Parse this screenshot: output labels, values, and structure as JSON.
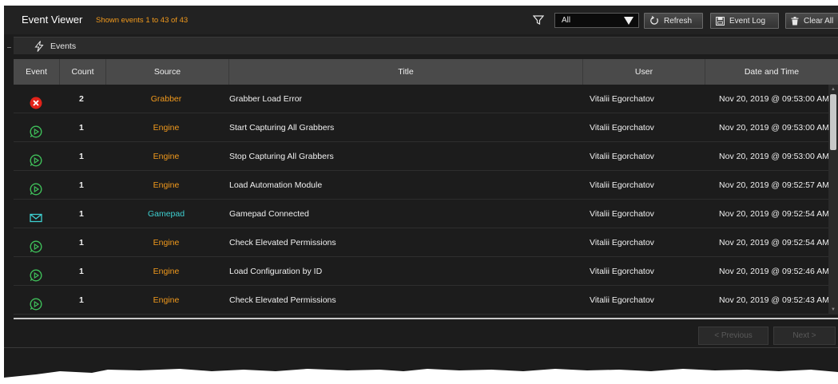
{
  "header": {
    "title": "Event Viewer",
    "shown_text": "Shown events 1 to 43 of 43",
    "filter_value": "All",
    "refresh_label": "Refresh",
    "event_log_label": "Event Log",
    "clear_all_label": "Clear All"
  },
  "section": {
    "label": "Events"
  },
  "columns": [
    "Event",
    "Count",
    "Source",
    "Title",
    "User",
    "Date and Time"
  ],
  "rows": [
    {
      "icon": "error-icon",
      "count": "2",
      "source": "Grabber",
      "title": "Grabber Load Error",
      "user": "Vitalii Egorchatov",
      "date": "Nov 20, 2019 @ 09:53:00 AM"
    },
    {
      "icon": "play-circle-icon",
      "count": "1",
      "source": "Engine",
      "title": "Start Capturing All Grabbers",
      "user": "Vitalii Egorchatov",
      "date": "Nov 20, 2019 @ 09:53:00 AM"
    },
    {
      "icon": "play-circle-icon",
      "count": "1",
      "source": "Engine",
      "title": "Stop Capturing All Grabbers",
      "user": "Vitalii Egorchatov",
      "date": "Nov 20, 2019 @ 09:53:00 AM"
    },
    {
      "icon": "play-circle-icon",
      "count": "1",
      "source": "Engine",
      "title": "Load Automation Module",
      "user": "Vitalii Egorchatov",
      "date": "Nov 20, 2019 @ 09:52:57 AM"
    },
    {
      "icon": "envelope-icon",
      "count": "1",
      "source": "Gamepad",
      "title": "Gamepad Connected",
      "user": "Vitalii Egorchatov",
      "date": "Nov 20, 2019 @ 09:52:54 AM"
    },
    {
      "icon": "play-circle-icon",
      "count": "1",
      "source": "Engine",
      "title": "Check Elevated Permissions",
      "user": "Vitalii Egorchatov",
      "date": "Nov 20, 2019 @ 09:52:54 AM"
    },
    {
      "icon": "play-circle-icon",
      "count": "1",
      "source": "Engine",
      "title": "Load Configuration by ID",
      "user": "Vitalii Egorchatov",
      "date": "Nov 20, 2019 @ 09:52:46 AM"
    },
    {
      "icon": "play-circle-icon",
      "count": "1",
      "source": "Engine",
      "title": "Check Elevated Permissions",
      "user": "Vitalii Egorchatov",
      "date": "Nov 20, 2019 @ 09:52:43 AM"
    }
  ],
  "pagination": {
    "previous_label": "Previous",
    "next_label": "Next"
  },
  "colors": {
    "accent_orange": "#f29a1c",
    "accent_teal": "#3ecfd0",
    "success_green": "#3fbf5a",
    "error_red": "#e2231a",
    "background": "#1c1c1c"
  }
}
